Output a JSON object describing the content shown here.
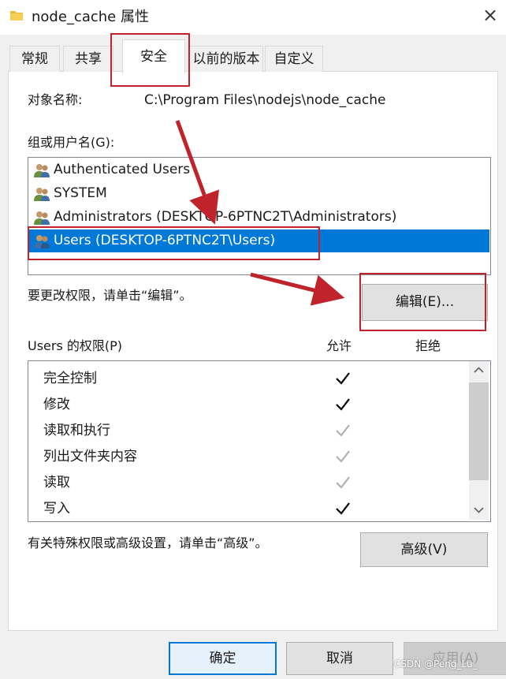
{
  "window": {
    "title": "node_cache 属性",
    "folder_icon": "folder-icon",
    "close_glyph": "×"
  },
  "tabs": [
    {
      "label": "常规"
    },
    {
      "label": "共享"
    },
    {
      "label": "安全",
      "active": true
    },
    {
      "label": "以前的版本"
    },
    {
      "label": "自定义"
    }
  ],
  "security": {
    "object_label": "对象名称:",
    "object_path": "C:\\Program Files\\nodejs\\node_cache",
    "group_label": "组或用户名(G):",
    "groups": [
      {
        "name": "Authenticated Users",
        "icon": "users-icon"
      },
      {
        "name": "SYSTEM",
        "icon": "users-icon"
      },
      {
        "name": "Administrators (DESKTOP-6PTNC2T\\Administrators)",
        "icon": "users-icon"
      },
      {
        "name": "Users (DESKTOP-6PTNC2T\\Users)",
        "icon": "users-icon",
        "selected": true
      }
    ],
    "edit_hint": "要更改权限，请单击“编辑”。",
    "edit_button": "编辑(E)...",
    "permissions_label": "Users 的权限(P)",
    "allow_header": "允许",
    "deny_header": "拒绝",
    "permissions": [
      {
        "name": "完全控制",
        "allow": "explicit",
        "deny": false
      },
      {
        "name": "修改",
        "allow": "explicit",
        "deny": false
      },
      {
        "name": "读取和执行",
        "allow": "inherited",
        "deny": false
      },
      {
        "name": "列出文件夹内容",
        "allow": "inherited",
        "deny": false
      },
      {
        "name": "读取",
        "allow": "inherited",
        "deny": false
      },
      {
        "name": "写入",
        "allow": "explicit",
        "deny": false
      }
    ],
    "advanced_hint": "有关特殊权限或高级设置，请单击“高级”。",
    "advanced_button": "高级(V)"
  },
  "footer": {
    "ok": "确定",
    "cancel": "取消",
    "apply": "应用(A)"
  },
  "watermark": "CSDN @Peng_Lu_",
  "colors": {
    "selection": "#0078d7",
    "annotation": "#c0232b",
    "check_explicit": "#000000",
    "check_inherited": "#b0b0b0"
  }
}
